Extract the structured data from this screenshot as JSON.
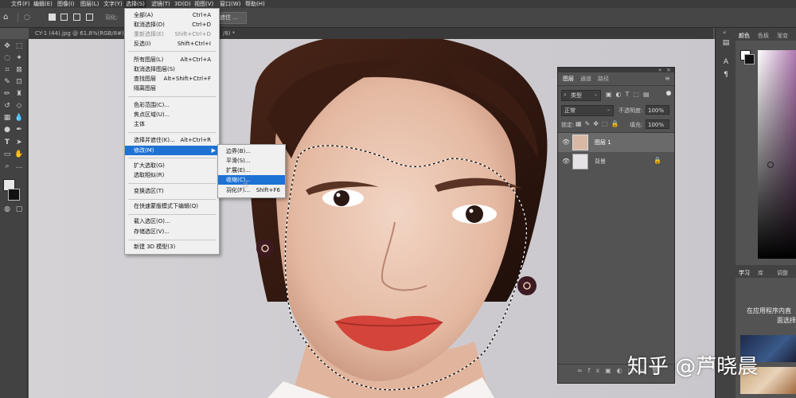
{
  "menubar": {
    "items": [
      {
        "label": "文件(F)"
      },
      {
        "label": "编辑(E)"
      },
      {
        "label": "图像(I)"
      },
      {
        "label": "图层(L)"
      },
      {
        "label": "文字(Y)"
      },
      {
        "label": "选择(S)"
      },
      {
        "label": "滤镜(T)"
      },
      {
        "label": "3D(D)"
      },
      {
        "label": "视图(V)"
      },
      {
        "label": "窗口(W)"
      },
      {
        "label": "帮助(H)"
      }
    ]
  },
  "options": {
    "feather_label": "羽化:",
    "select_mask_btn": "并遮住 ..."
  },
  "tabs": [
    {
      "label": "CY-1 (44).jpg @ 61.8%(RGB/8#)"
    },
    {
      "label": "/8) *"
    }
  ],
  "select_menu": {
    "items": [
      {
        "label": "全部(A)",
        "shortcut": "Ctrl+A"
      },
      {
        "label": "取消选择(D)",
        "shortcut": "Ctrl+D"
      },
      {
        "label": "重新选择(E)",
        "shortcut": "Shift+Ctrl+D"
      },
      {
        "label": "反选(I)",
        "shortcut": "Shift+Ctrl+I"
      },
      {
        "label": "所有图层(L)",
        "shortcut": "Alt+Ctrl+A"
      },
      {
        "label": "取消选择图层(S)",
        "shortcut": ""
      },
      {
        "label": "查找图层",
        "shortcut": "Alt+Shift+Ctrl+F"
      },
      {
        "label": "隔离图层",
        "shortcut": ""
      },
      {
        "label": "色彩范围(C)...",
        "shortcut": ""
      },
      {
        "label": "焦点区域(U)...",
        "shortcut": ""
      },
      {
        "label": "主体",
        "shortcut": ""
      },
      {
        "label": "选择并遮住(K)...",
        "shortcut": "Alt+Ctrl+R"
      },
      {
        "label": "修改(M)",
        "shortcut": ""
      },
      {
        "label": "扩大选取(G)",
        "shortcut": ""
      },
      {
        "label": "选取相似(R)",
        "shortcut": ""
      },
      {
        "label": "变换选区(T)",
        "shortcut": ""
      },
      {
        "label": "在快速蒙版模式下编辑(Q)",
        "shortcut": ""
      },
      {
        "label": "载入选区(O)...",
        "shortcut": ""
      },
      {
        "label": "存储选区(V)...",
        "shortcut": ""
      },
      {
        "label": "新建 3D 模型(3)",
        "shortcut": ""
      }
    ]
  },
  "modify_submenu": {
    "items": [
      {
        "label": "边界(B)...",
        "shortcut": ""
      },
      {
        "label": "平滑(S)...",
        "shortcut": ""
      },
      {
        "label": "扩展(E)...",
        "shortcut": ""
      },
      {
        "label": "收缩(C)...",
        "shortcut": ""
      },
      {
        "label": "羽化(F)...",
        "shortcut": "Shift+F6"
      }
    ]
  },
  "layers_panel": {
    "tabs": [
      "图层",
      "通道",
      "路径"
    ],
    "filter_kind": "类型",
    "blend_mode": "正常",
    "opacity_label": "不透明度:",
    "opacity_value": "100%",
    "lock_label": "锁定:",
    "fill_label": "填充:",
    "fill_value": "100%",
    "layers": [
      {
        "name": "图层 1"
      },
      {
        "name": "背景"
      }
    ]
  },
  "right_panel": {
    "tabs_top": [
      "颜色",
      "色板",
      "渐变"
    ],
    "tabs_mid": [
      "学习",
      "库",
      "调整"
    ],
    "learn_text_1": "在应用程序内直",
    "learn_text_2": "面选择"
  },
  "watermark": "知乎 @芦晓晨",
  "colors": {
    "highlight": "#1e72d4",
    "menu_bg": "#f0f0f0",
    "panel_bg": "#535353"
  }
}
